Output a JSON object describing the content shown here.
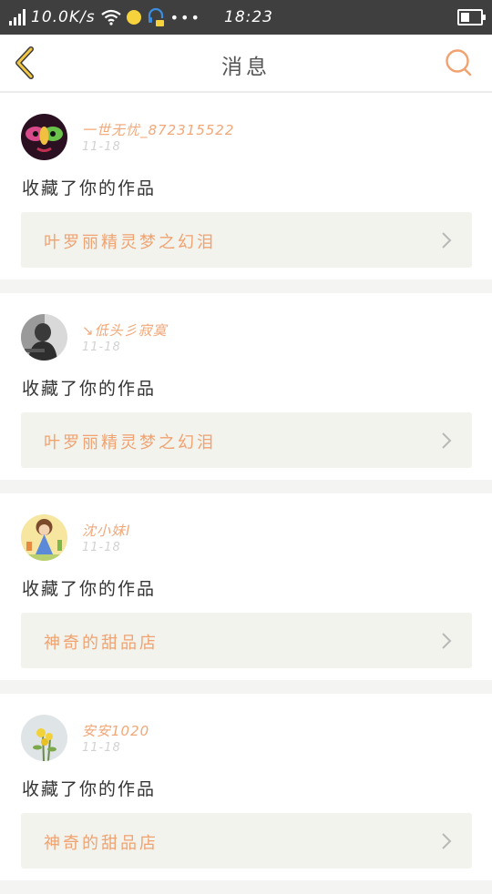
{
  "status_bar": {
    "net_speed": "10.0K/s",
    "time": "18:23"
  },
  "nav": {
    "title": "消息",
    "back_icon": "chevron-left-icon",
    "search_icon": "search-icon",
    "accent_color": "#f0a270"
  },
  "notifications": [
    {
      "username": "一世无忧_872315522",
      "date": "11-18",
      "action": "收藏了你的作品",
      "work_title": "叶罗丽精灵梦之幻泪",
      "avatar": "butterfly-face"
    },
    {
      "username": "↘低头彡寂寞",
      "date": "11-18",
      "action": "收藏了你的作品",
      "work_title": "叶罗丽精灵梦之幻泪",
      "avatar": "dark-portrait"
    },
    {
      "username": "沈小妹l",
      "date": "11-18",
      "action": "收藏了你的作品",
      "work_title": "神奇的甜品店",
      "avatar": "cartoon-figure"
    },
    {
      "username": "安安1020",
      "date": "11-18",
      "action": "收藏了你的作品",
      "work_title": "神奇的甜品店",
      "avatar": "yellow-flowers"
    }
  ]
}
